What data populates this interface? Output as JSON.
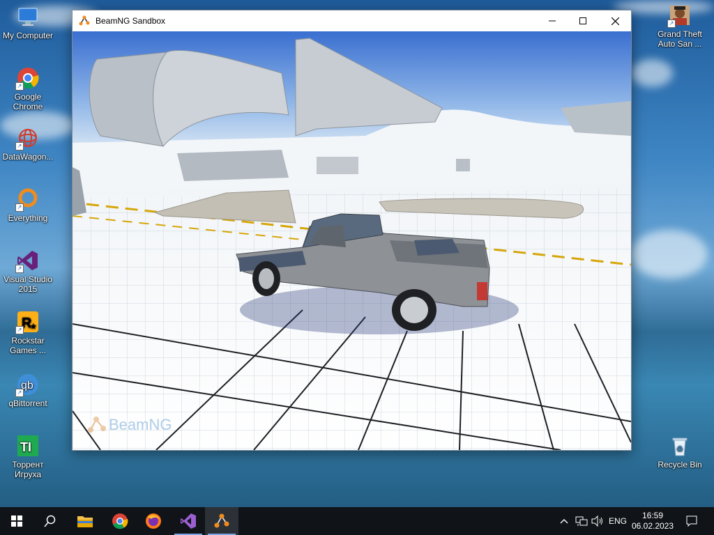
{
  "desktop": {
    "left_icons": [
      {
        "label": "My Computer",
        "icon": "computer-icon"
      },
      {
        "label": "Google Chrome",
        "icon": "chrome-icon"
      },
      {
        "label": "DataWagon...",
        "icon": "datawagon-icon"
      },
      {
        "label": "Everything",
        "icon": "everything-icon"
      },
      {
        "label": "Visual Studio 2015",
        "icon": "visual-studio-icon"
      },
      {
        "label": "Rockstar Games ...",
        "icon": "rockstar-icon"
      },
      {
        "label": "qBittorrent",
        "icon": "qbittorrent-icon"
      },
      {
        "label": "Торрент Игруха",
        "icon": "torrent-igruha-icon"
      }
    ],
    "right_icons": [
      {
        "label": "Grand Theft Auto San ...",
        "icon": "gta-icon"
      },
      {
        "label": "Recycle Bin",
        "icon": "recycle-bin-icon"
      }
    ]
  },
  "window": {
    "title": "BeamNG Sandbox",
    "minimize_symbol": "—",
    "maximize_symbol": "☐",
    "close_symbol": "✕",
    "watermark": "BeamNG"
  },
  "taskbar": {
    "apps": [
      {
        "name": "file-explorer",
        "icon": "folder-icon"
      },
      {
        "name": "chrome",
        "icon": "chrome-icon"
      },
      {
        "name": "firefox",
        "icon": "firefox-icon"
      },
      {
        "name": "visual-studio",
        "icon": "visual-studio-icon"
      },
      {
        "name": "beamng",
        "icon": "beamng-icon"
      }
    ],
    "language": "ENG",
    "time": "16:59",
    "date": "06.02.2023"
  },
  "colors": {
    "taskbar_bg": "#101317",
    "active_indicator": "#7aa7e6",
    "vs_purple": "#68217a",
    "beamng_orange": "#f08c1e"
  }
}
